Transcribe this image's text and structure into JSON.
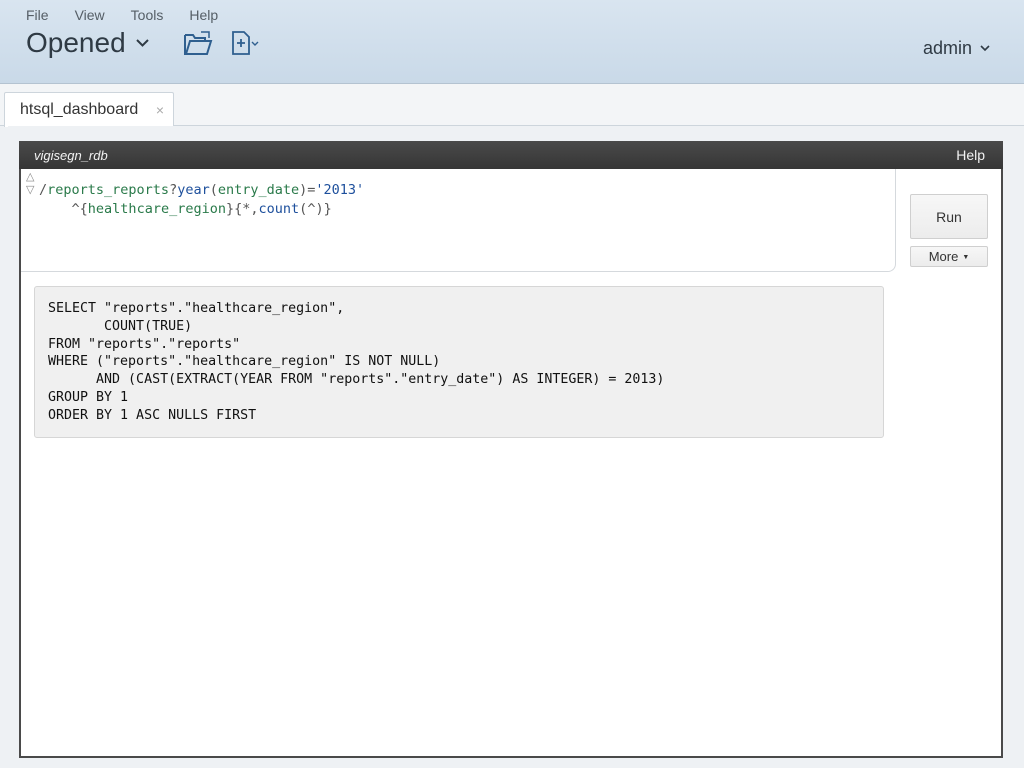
{
  "menu": {
    "file": "File",
    "view": "View",
    "tools": "Tools",
    "help": "Help"
  },
  "header": {
    "title": "Opened",
    "user": "admin"
  },
  "tab": {
    "label": "htsql_dashboard",
    "close": "×"
  },
  "panel": {
    "db_name": "vigisegn_rdb",
    "help": "Help"
  },
  "query": {
    "line1": {
      "slash": "/",
      "table": "reports_reports",
      "q": "?",
      "fn": "year",
      "open": "(",
      "arg": "entry_date",
      "close": ")",
      "eq": "=",
      "str": "'2013'"
    },
    "line2": {
      "indent": "    ",
      "caret": "^",
      "ob": "{",
      "group": "healthcare_region",
      "cb": "}",
      "ob2": "{",
      "star": "*",
      "comma": ",",
      "count": "count",
      "po": "(",
      "cx": "^",
      "pc": ")",
      "cb2": "}"
    }
  },
  "buttons": {
    "run": "Run",
    "more": "More",
    "more_caret": "▼"
  },
  "sql": {
    "lines": [
      "SELECT \"reports\".\"healthcare_region\",",
      "       COUNT(TRUE)",
      "FROM \"reports\".\"reports\"",
      "WHERE (\"reports\".\"healthcare_region\" IS NOT NULL)",
      "      AND (CAST(EXTRACT(YEAR FROM \"reports\".\"entry_date\") AS INTEGER) = 2013)",
      "GROUP BY 1",
      "ORDER BY 1 ASC NULLS FIRST"
    ]
  },
  "colors": {
    "header_bg": "#d3e1ee",
    "panel_header": "#3f3f3f",
    "accent_text": "#1d4f9c"
  },
  "icons": {
    "open_folder": "folder-open-icon",
    "new_file": "new-file-icon",
    "chevron": "chevron-down-icon"
  }
}
